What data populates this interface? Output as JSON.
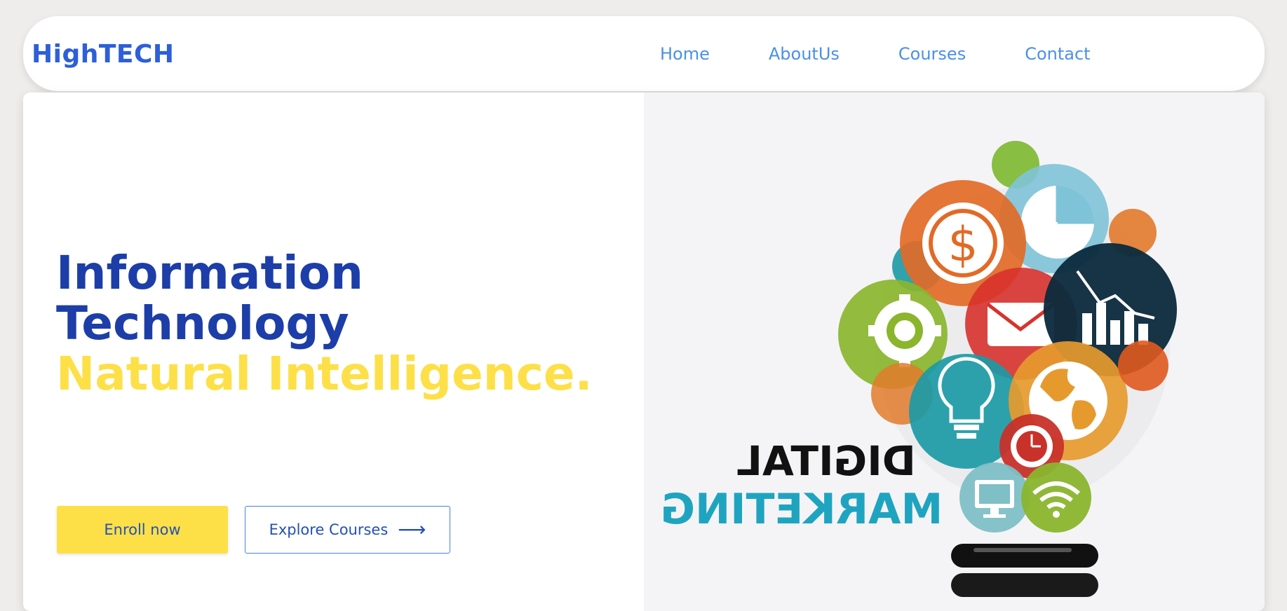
{
  "nav": {
    "brand": "HighTECH",
    "links": [
      "Home",
      "AboutUs",
      "Courses",
      "Contact"
    ]
  },
  "hero": {
    "headline_line1": "Information",
    "headline_line2": "Technology",
    "headline_line3": "Natural Intelligence.",
    "enroll_label": "Enroll now",
    "explore_label": "Explore Courses",
    "illustration": {
      "caption_line1": "DIGITAL",
      "caption_line2": "MARKETING",
      "icons": [
        "dollar-icon",
        "pie-chart-icon",
        "envelope-icon",
        "bar-chart-icon",
        "gear-icon",
        "lightbulb-icon",
        "globe-icon",
        "clock-icon",
        "monitor-icon",
        "wifi-icon"
      ]
    }
  },
  "colors": {
    "brand_blue": "#2d5fd8",
    "nav_link": "#4a90e6",
    "headline_blue": "#1d3ea8",
    "accent_yellow": "#fde047",
    "button_text": "#2450b5"
  }
}
